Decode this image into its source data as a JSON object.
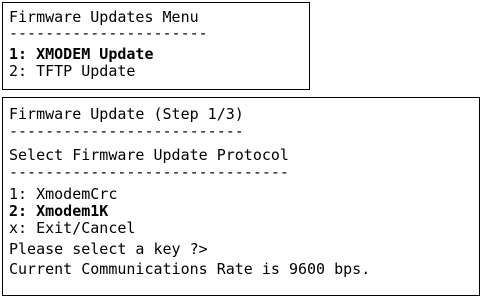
{
  "firmware_menu": {
    "title": "Firmware Updates Menu",
    "separator": "----------------------",
    "items": [
      {
        "label": "1: XMODEM Update",
        "selected": true
      },
      {
        "label": "2: TFTP Update",
        "selected": false
      }
    ]
  },
  "update_step": {
    "title": "Firmware Update (Step 1/3)",
    "title_separator": "--------------------------",
    "subtitle": "Select Firmware Update Protocol",
    "subtitle_separator": "-------------------------------",
    "options": [
      {
        "label": "1: XmodemCrc",
        "selected": false
      },
      {
        "label": "2: Xmodem1K",
        "selected": true
      },
      {
        "label": "x: Exit/Cancel",
        "selected": false
      }
    ],
    "prompt": "Please select a key ?>",
    "status": "Current Communications Rate is 9600 bps."
  }
}
